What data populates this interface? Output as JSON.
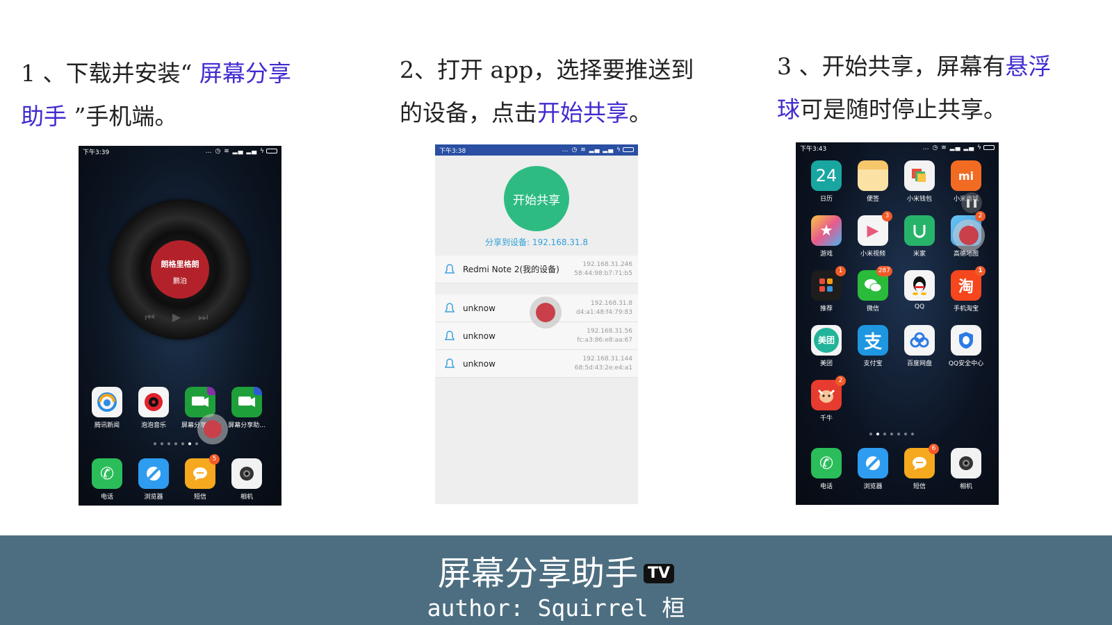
{
  "steps": [
    {
      "pre": "1 、下载并安装“ ",
      "highlight": "屏幕分享",
      "line2_highlight": "助手",
      "post": " ”手机端。"
    },
    {
      "line1": "2、打开 app，选择要推送到",
      "line2_pre": "的设备，点击",
      "highlight": "开始共享",
      "post": "。"
    },
    {
      "line1_pre": "3 、开始共享，屏幕有",
      "highlight_a": "悬浮",
      "highlight_b": "球",
      "post": "可是随时停止共享。"
    }
  ],
  "phone1": {
    "time": "下午3:39",
    "song_title": "朗格里格朗",
    "artist": "鹏泊",
    "controls": "⏮ ▶ ⏭",
    "apps": [
      {
        "label": "腾讯新闻",
        "icon": "tencent-news-icon"
      },
      {
        "label": "泡泡音乐",
        "icon": "music-icon"
      },
      {
        "label": "屏幕分享助手",
        "icon": "screen-share-icon"
      },
      {
        "label": "屏幕分享助...",
        "icon": "screen-share-tv-icon"
      }
    ],
    "dock": [
      {
        "label": "电话",
        "icon": "phone-icon"
      },
      {
        "label": "浏览器",
        "icon": "browser-icon"
      },
      {
        "label": "短信",
        "icon": "sms-icon",
        "badge": "5"
      },
      {
        "label": "相机",
        "icon": "camera-icon"
      }
    ]
  },
  "phone2": {
    "time": "下午3:38",
    "start_button": "开始共享",
    "share_target": "分享到设备: 192.168.31.8",
    "devices": [
      {
        "name": "Redmi Note 2(我的设备)",
        "ip": "192.168.31.246",
        "mac": "58:44:98:b7:71:b5"
      },
      {
        "name": "unknow",
        "ip": "192.168.31.8",
        "mac": "d4:a1:48:f4:79:83"
      },
      {
        "name": "unknow",
        "ip": "192.168.31.56",
        "mac": "fc:a3:86:e8:aa:67"
      },
      {
        "name": "unknow",
        "ip": "192.168.31.144",
        "mac": "68:5d:43:2e:e4:a1"
      }
    ]
  },
  "phone3": {
    "time": "下午3:43",
    "apps": [
      {
        "label": "日历",
        "icon": "calendar-icon",
        "text": "24"
      },
      {
        "label": "便签",
        "icon": "notes-icon"
      },
      {
        "label": "小米钱包",
        "icon": "wallet-icon"
      },
      {
        "label": "小米商城",
        "icon": "mi-store-icon",
        "text": "mi"
      },
      {
        "label": "游戏",
        "icon": "games-icon",
        "text": "★"
      },
      {
        "label": "小米视频",
        "icon": "video-icon",
        "text": "▶",
        "badge": "3"
      },
      {
        "label": "米家",
        "icon": "mijia-icon"
      },
      {
        "label": "高德地图",
        "icon": "map-icon",
        "badge": "2"
      },
      {
        "label": "推荐",
        "icon": "recommend-icon",
        "badge": "1"
      },
      {
        "label": "微信",
        "icon": "wechat-icon",
        "badge": "287"
      },
      {
        "label": "QQ",
        "icon": "qq-icon"
      },
      {
        "label": "手机淘宝",
        "icon": "taobao-icon",
        "text": "淘",
        "badge": "1"
      },
      {
        "label": "美团",
        "icon": "meituan-icon",
        "text": "美团"
      },
      {
        "label": "支付宝",
        "icon": "alipay-icon",
        "text": "支"
      },
      {
        "label": "百度网盘",
        "icon": "baidu-pan-icon"
      },
      {
        "label": "QQ安全中心",
        "icon": "qq-security-icon"
      },
      {
        "label": "千牛",
        "icon": "qianniu-icon",
        "badge": "2"
      }
    ],
    "dock": [
      {
        "label": "电话",
        "icon": "phone-icon"
      },
      {
        "label": "浏览器",
        "icon": "browser-icon"
      },
      {
        "label": "短信",
        "icon": "sms-icon",
        "badge": "6"
      },
      {
        "label": "相机",
        "icon": "camera-icon"
      }
    ]
  },
  "footer": {
    "title": "屏幕分享助手",
    "tv_badge": "TV",
    "author": "author: Squirrel 桓"
  }
}
